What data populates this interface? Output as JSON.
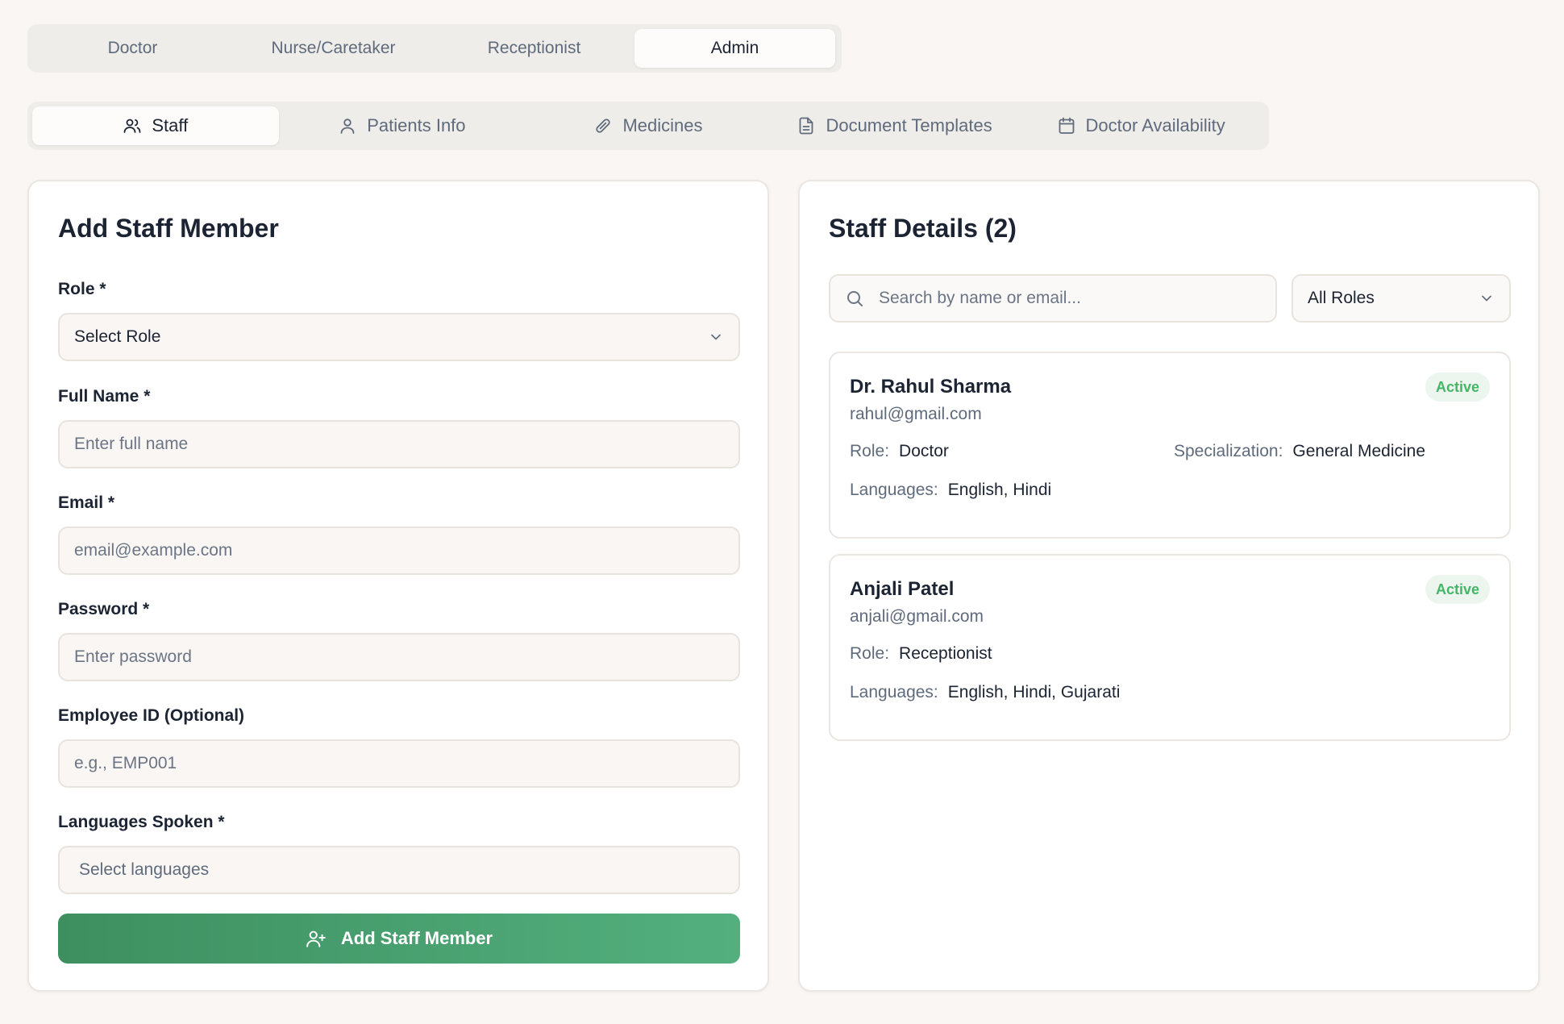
{
  "role_tabs": [
    {
      "label": "Doctor"
    },
    {
      "label": "Nurse/Caretaker"
    },
    {
      "label": "Receptionist"
    },
    {
      "label": "Admin"
    }
  ],
  "active_role_tab": "Admin",
  "section_tabs": [
    {
      "label": "Staff",
      "icon": "users-icon"
    },
    {
      "label": "Patients Info",
      "icon": "user-icon"
    },
    {
      "label": "Medicines",
      "icon": "pill-icon"
    },
    {
      "label": "Document Templates",
      "icon": "document-icon"
    },
    {
      "label": "Doctor Availability",
      "icon": "calendar-icon"
    }
  ],
  "active_section_tab": "Staff",
  "form": {
    "title": "Add Staff Member",
    "role_label": "Role *",
    "role_value": "Select Role",
    "name_label": "Full Name *",
    "name_placeholder": "Enter full name",
    "email_label": "Email *",
    "email_placeholder": "email@example.com",
    "password_label": "Password *",
    "password_placeholder": "Enter password",
    "employee_id_label": "Employee ID (Optional)",
    "employee_id_placeholder": "e.g., EMP001",
    "languages_label": "Languages Spoken *",
    "languages_value": "Select languages",
    "submit_label": "Add Staff Member"
  },
  "staff_panel": {
    "title": "Staff Details (2)",
    "search_placeholder": "Search by name or email...",
    "role_filter": "All Roles",
    "members": [
      {
        "name": "Dr. Rahul Sharma",
        "email": "rahul@gmail.com",
        "status": "Active",
        "role_key": "Role:",
        "role": "Doctor",
        "specialization_key": "Specialization:",
        "specialization": "General Medicine",
        "languages_key": "Languages:",
        "languages": "English, Hindi"
      },
      {
        "name": "Anjali Patel",
        "email": "anjali@gmail.com",
        "status": "Active",
        "role_key": "Role:",
        "role": "Receptionist",
        "languages_key": "Languages:",
        "languages": "English, Hindi, Gujarati"
      }
    ]
  },
  "colors": {
    "background": "#f9f6f3",
    "accent_green_start": "#3e8f60",
    "accent_green_end": "#53b07e",
    "active_badge_text": "#43b766",
    "active_badge_bg": "#ecf6ef"
  }
}
